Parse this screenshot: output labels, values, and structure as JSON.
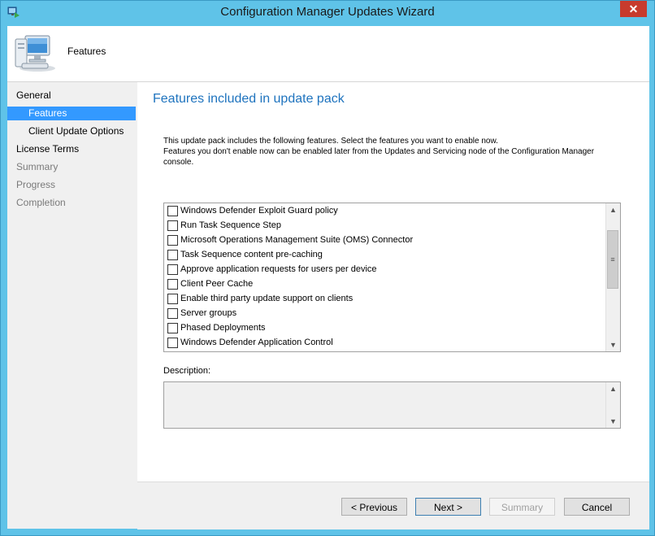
{
  "window": {
    "title": "Configuration Manager Updates Wizard",
    "close_glyph": "✕"
  },
  "header": {
    "title": "Features",
    "icon": "computer-icon"
  },
  "sidebar": {
    "items": [
      {
        "label": "General",
        "state": "normal"
      },
      {
        "label": "Features",
        "state": "selected"
      },
      {
        "label": "Client Update Options",
        "state": "normal"
      },
      {
        "label": "License Terms",
        "state": "normal"
      },
      {
        "label": "Summary",
        "state": "disabled"
      },
      {
        "label": "Progress",
        "state": "disabled"
      },
      {
        "label": "Completion",
        "state": "disabled"
      }
    ]
  },
  "main": {
    "heading": "Features included in update pack",
    "intro_line1": "This update pack includes the following features. Select the features you want to enable now.",
    "intro_line2": "Features you don't enable now can be enabled later from the Updates and Servicing node of the Configuration Manager console.",
    "features": [
      {
        "label": "Windows Defender Exploit Guard policy",
        "checked": false
      },
      {
        "label": "Run Task Sequence Step",
        "checked": false
      },
      {
        "label": "Microsoft Operations Management Suite (OMS) Connector",
        "checked": false
      },
      {
        "label": "Task Sequence content pre-caching",
        "checked": false
      },
      {
        "label": "Approve application requests for users per device",
        "checked": false
      },
      {
        "label": "Client Peer Cache",
        "checked": false
      },
      {
        "label": "Enable third party update support on clients",
        "checked": false
      },
      {
        "label": "Server groups",
        "checked": false
      },
      {
        "label": "Phased Deployments",
        "checked": false
      },
      {
        "label": "Windows Defender Application Control",
        "checked": false
      }
    ],
    "description_label": "Description:",
    "description_value": ""
  },
  "footer": {
    "previous": "< Previous",
    "next": "Next >",
    "summary": "Summary",
    "cancel": "Cancel"
  },
  "colors": {
    "titlebar": "#5fc3e8",
    "selection": "#3399ff",
    "heading": "#1e73be",
    "close": "#c73b2d"
  }
}
